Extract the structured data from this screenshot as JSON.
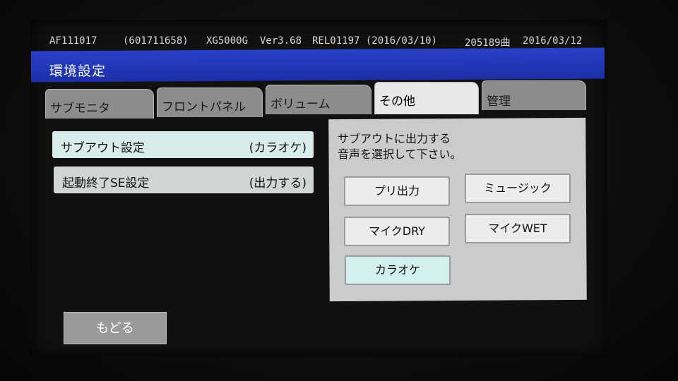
{
  "info": {
    "device_id": "AF111017",
    "serial": "(601711658)",
    "model": "XG5000G",
    "version": "Ver3.68",
    "release": "REL01197 (2016/03/10)",
    "songs": "205189曲",
    "date": "2016/03/12"
  },
  "title": "環境設定",
  "tabs": [
    {
      "label": "サブモニタ",
      "active": false
    },
    {
      "label": "フロントパネル",
      "active": false
    },
    {
      "label": "ボリューム",
      "active": false
    },
    {
      "label": "その他",
      "active": true
    },
    {
      "label": "管理",
      "active": false
    }
  ],
  "settings": [
    {
      "label": "サブアウト設定",
      "value": "(カラオケ)",
      "active": true
    },
    {
      "label": "起動終了SE設定",
      "value": "(出力する)",
      "active": false
    }
  ],
  "prompt": {
    "line1": "サブアウトに出力する",
    "line2": "音声を選択して下さい。"
  },
  "options": [
    {
      "label": "プリ出力",
      "selected": false
    },
    {
      "label": "ミュージック",
      "selected": false
    },
    {
      "label": "マイクDRY",
      "selected": false
    },
    {
      "label": "マイクWET",
      "selected": false
    },
    {
      "label": "カラオケ",
      "selected": true
    }
  ],
  "back_label": "もどる",
  "colors": {
    "title_bar": "#2238c0",
    "selected_option": "#d3f0ee",
    "tab_inactive": "#8c8c8c"
  }
}
